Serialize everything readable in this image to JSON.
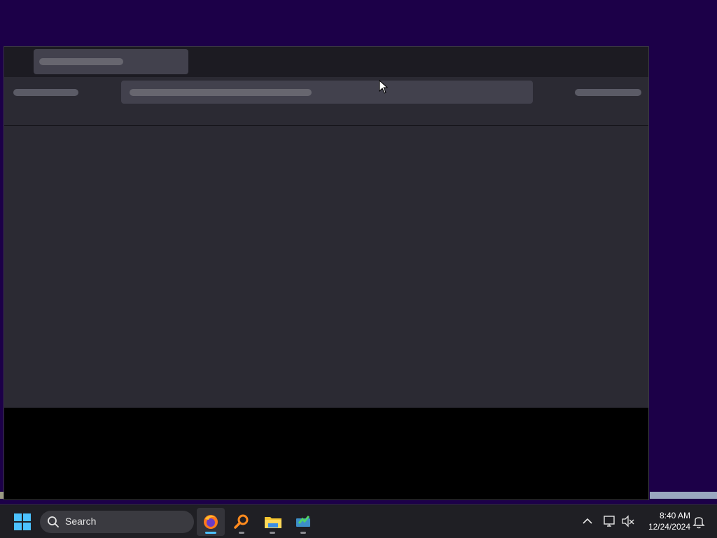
{
  "taskbar": {
    "search_placeholder": "Search",
    "apps": [
      {
        "name": "Firefox",
        "icon": "firefox-icon",
        "active": true
      },
      {
        "name": "Search tool",
        "icon": "magnifier-app-icon",
        "active": false
      },
      {
        "name": "File Explorer",
        "icon": "folder-icon",
        "active": false
      },
      {
        "name": "App",
        "icon": "app-green-icon",
        "active": false
      }
    ],
    "clock": {
      "time": "8:40 AM",
      "date": "12/24/2024"
    }
  },
  "colors": {
    "desktop": "#1c0048",
    "window_bg": "#2b2a33",
    "tabbar_bg": "#1c1b22",
    "accent": "#4cc2ff"
  }
}
